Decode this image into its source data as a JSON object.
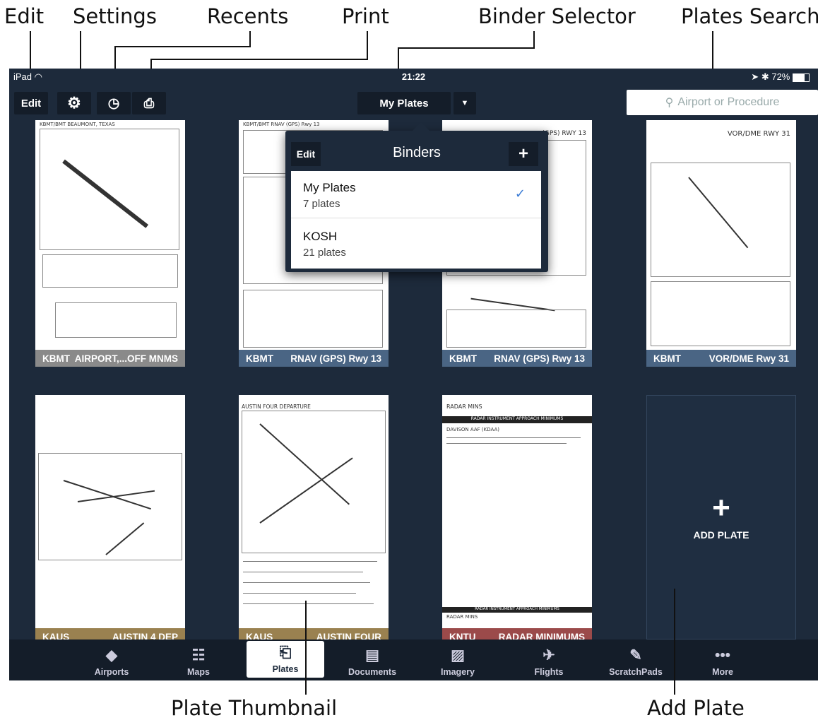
{
  "callouts": {
    "edit": "Edit",
    "settings": "Settings",
    "recents": "Recents",
    "print": "Print",
    "binder_selector": "Binder Selector",
    "plates_search": "Plates Search",
    "plate_thumbnail": "Plate Thumbnail",
    "add_plate": "Add Plate"
  },
  "status_bar": {
    "device": "iPad",
    "time": "21:22",
    "battery": "72%"
  },
  "toolbar": {
    "edit_label": "Edit",
    "binder_label": "My Plates",
    "search_placeholder": "Airport or Procedure"
  },
  "binders_popup": {
    "edit_label": "Edit",
    "title": "Binders",
    "add_label": "+",
    "items": [
      {
        "name": "My Plates",
        "count": "7 plates",
        "selected": true
      },
      {
        "name": "KOSH",
        "count": "21 plates",
        "selected": false
      }
    ]
  },
  "plates": [
    {
      "airport": "KBMT",
      "name": "AIRPORT,...OFF MNMS",
      "color": "#8a8a8a"
    },
    {
      "airport": "KBMT",
      "name": "RNAV (GPS) Rwy 13",
      "color": "#4a6584"
    },
    {
      "airport": "KBMT",
      "name": "RNAV (GPS) Rwy 13",
      "color": "#4a6584"
    },
    {
      "airport": "KBMT",
      "name": "VOR/DME Rwy 31",
      "color": "#4a6584"
    },
    {
      "airport": "KAUS",
      "name": "AUSTIN 4 DEP",
      "color": "#9a8150"
    },
    {
      "airport": "KAUS",
      "name": "AUSTIN FOUR",
      "color": "#9a8150"
    },
    {
      "airport": "KNTU",
      "name": "RADAR MINIMUMS",
      "color": "#9b4a4a"
    }
  ],
  "add_plate": {
    "icon": "+",
    "label": "ADD PLATE"
  },
  "tabs": [
    {
      "label": "Airports",
      "icon": "airport-icon"
    },
    {
      "label": "Maps",
      "icon": "map-icon"
    },
    {
      "label": "Plates",
      "icon": "plates-icon",
      "active": true
    },
    {
      "label": "Documents",
      "icon": "documents-icon"
    },
    {
      "label": "Imagery",
      "icon": "imagery-icon"
    },
    {
      "label": "Flights",
      "icon": "flights-icon"
    },
    {
      "label": "ScratchPads",
      "icon": "scratchpads-icon"
    },
    {
      "label": "More",
      "icon": "more-icon"
    }
  ],
  "plate_texts": {
    "p0_header": "KBMT/BMT  BEAUMONT, TEXAS",
    "p1_header": "KBMT/BMT  RNAV (GPS) Rwy 13",
    "p2_header": "(GPS) RWY 13",
    "p3_header": "VOR/DME RWY 31",
    "p5_header": "AUSTIN FOUR DEPARTURE",
    "p6_title": "RADAR MINS",
    "p6_sub": "RADAR INSTRUMENT APPROACH MINIMUMS",
    "p6_line": "DAVISON AAF (KDAA)",
    "p6_footer": "RADAR INSTRUMENT APPROACH MINIMUMS",
    "p6_footer2": "RADAR MINS"
  }
}
